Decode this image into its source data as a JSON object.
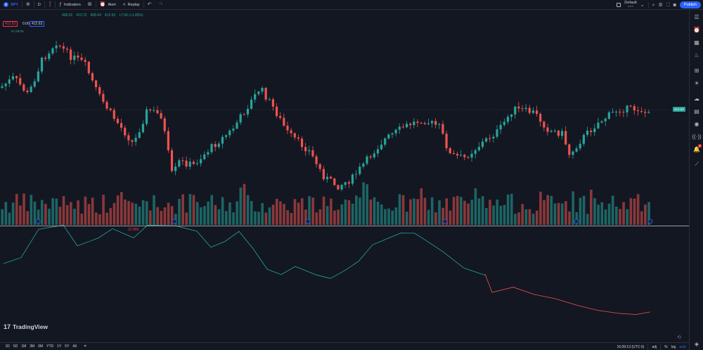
{
  "toolbar": {
    "symbol_letter": "S",
    "symbol": "SPY",
    "interval": "D",
    "indicators_label": "Indicators",
    "alert_label": "Alert",
    "replay_label": "Replay",
    "layout_name": "Default",
    "layout_sub": "save",
    "publish_label": "Publish"
  },
  "legend": {
    "open": "408.91",
    "high": "413.72",
    "low": "408.64",
    "close": "412.63",
    "change": "+7.50 (+1.85%)",
    "bid": "412.63",
    "spread": "0.00",
    "ask": "412.63",
    "volume": "87.687M"
  },
  "price_tag": "412.63",
  "indicator_value": "22.899",
  "brand": "TradingView",
  "ranges": [
    "1D",
    "5D",
    "1M",
    "3M",
    "6M",
    "YTD",
    "1Y",
    "5Y",
    "All"
  ],
  "status": {
    "time": "16:09:13 (UTC-5)",
    "adj": "adj",
    "percent": "%",
    "log": "log",
    "auto": "auto"
  },
  "colors": {
    "up": "#26a69a",
    "down": "#ef5350",
    "background": "#131722",
    "accent": "#2962ff"
  },
  "icons": [
    "plus-circle-icon",
    "indicators-icon",
    "layout-grid-icon",
    "alert-clock-icon",
    "replay-icon",
    "undo-icon",
    "redo-icon",
    "search-icon",
    "settings-icon",
    "fullscreen-icon",
    "camera-icon",
    "watchlist-icon",
    "alarm-icon",
    "calendar-icon",
    "hotlist-icon",
    "data-window-icon",
    "ideas-icon",
    "chat-icon",
    "news-icon",
    "streams-icon",
    "signals-icon",
    "notifications-icon",
    "trading-panel-icon",
    "layers-icon"
  ],
  "chart_data": {
    "type": "candlestick",
    "bars": 180,
    "last_close": 412.63,
    "volume_last": "87.687M",
    "indicator": {
      "type": "line",
      "last_value": 22.899,
      "color_before": "#26a69a",
      "color_after": "#ef5350"
    },
    "markers": [
      "dividend",
      "dividend",
      "dividend",
      "dividend",
      "dividend",
      "dividend"
    ]
  }
}
